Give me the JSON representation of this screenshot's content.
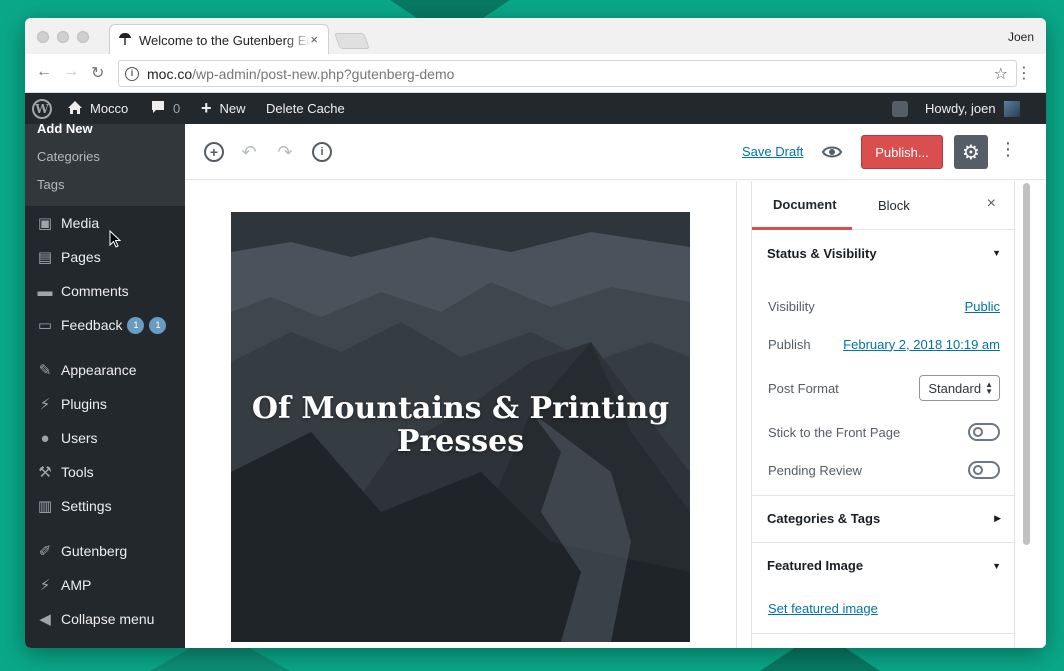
{
  "browser": {
    "tab_title": "Welcome to the Gutenberg Editor",
    "tab_close": "×",
    "profile_name": "Joen",
    "url_host": "moc.co",
    "url_path": "/wp-admin/post-new.php?gutenberg-demo"
  },
  "admin_bar": {
    "site_name": "Mocco",
    "comments_count": "0",
    "new_label": "New",
    "delete_cache_label": "Delete Cache",
    "greeting": "Howdy, joen"
  },
  "sidebar": {
    "submenu": [
      "Add New",
      "Categories",
      "Tags"
    ],
    "items": [
      {
        "label": "Media",
        "icon": "media-icon"
      },
      {
        "label": "Pages",
        "icon": "pages-icon"
      },
      {
        "label": "Comments",
        "icon": "comments-icon"
      },
      {
        "label": "Feedback",
        "icon": "feedback-icon",
        "badges": [
          "1",
          "1"
        ]
      },
      {
        "label": "Appearance",
        "icon": "appearance-icon"
      },
      {
        "label": "Plugins",
        "icon": "plugins-icon"
      },
      {
        "label": "Users",
        "icon": "users-icon"
      },
      {
        "label": "Tools",
        "icon": "tools-icon"
      },
      {
        "label": "Settings",
        "icon": "settings-icon"
      },
      {
        "label": "Gutenberg",
        "icon": "gutenberg-icon"
      },
      {
        "label": "AMP",
        "icon": "amp-icon"
      },
      {
        "label": "Collapse menu",
        "icon": "collapse-icon"
      }
    ]
  },
  "editor_toolbar": {
    "save_draft_label": "Save Draft",
    "publish_label": "Publish..."
  },
  "canvas": {
    "cover_title": "Of Mountains & Printing Presses"
  },
  "inspector": {
    "tabs": [
      "Document",
      "Block"
    ],
    "close": "×",
    "status_panel": {
      "title": "Status & Visibility",
      "visibility_label": "Visibility",
      "visibility_value": "Public",
      "publish_label": "Publish",
      "publish_value": "February 2, 2018 10:19 am",
      "post_format_label": "Post Format",
      "post_format_value": "Standard",
      "sticky_label": "Stick to the Front Page",
      "pending_label": "Pending Review"
    },
    "categories_panel": {
      "title": "Categories & Tags"
    },
    "featured_panel": {
      "title": "Featured Image",
      "set_label": "Set featured image"
    }
  },
  "colors": {
    "background": "#0aa889",
    "admin_dark": "#23282d",
    "publish_red": "#d94f4f",
    "link_blue": "#0073aa"
  }
}
